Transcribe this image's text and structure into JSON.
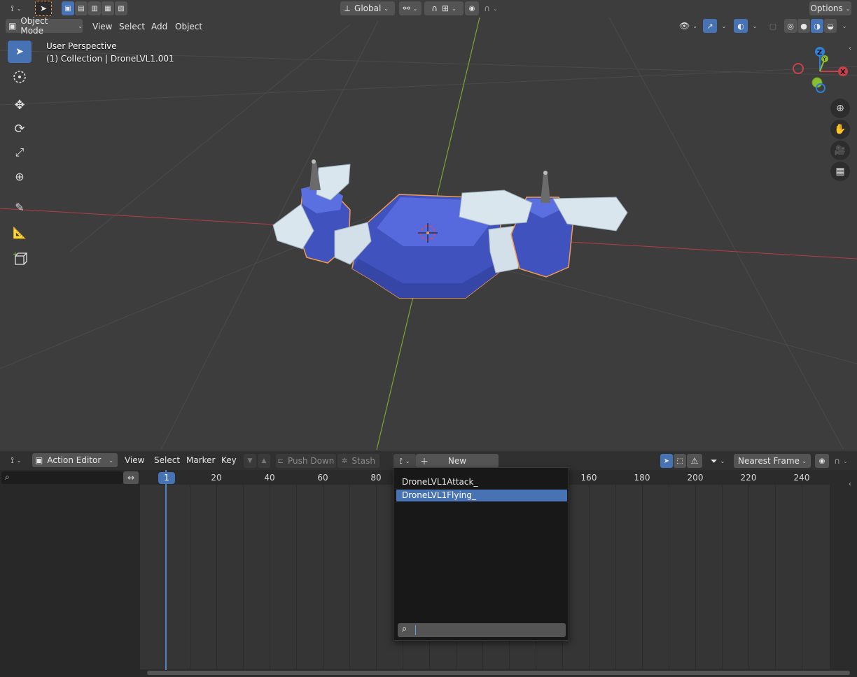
{
  "viewport_header": {
    "transform_orientation": "Global",
    "options_label": "Options"
  },
  "viewport_menu": {
    "mode": "Object Mode",
    "items": [
      "View",
      "Select",
      "Add",
      "Object"
    ]
  },
  "viewport_info": {
    "perspective": "User Perspective",
    "collection": "(1) Collection | DroneLVL1.001"
  },
  "gizmo": {
    "x": "X",
    "y": "Y",
    "z": "Z"
  },
  "action_editor": {
    "editor_type": "Action Editor",
    "menu": [
      "View",
      "Select",
      "Marker",
      "Key"
    ],
    "push_down": "Push Down",
    "stash": "Stash",
    "new_label": "New",
    "snapping": "Nearest Frame",
    "current_frame": "1",
    "ruler_ticks": [
      "20",
      "40",
      "60",
      "80",
      "160",
      "180",
      "200",
      "220",
      "240"
    ]
  },
  "action_popup": {
    "items": [
      "DroneLVL1Attack_",
      "DroneLVL1Flying_"
    ],
    "selected_index": 1
  },
  "colors": {
    "accent": "#4772b3",
    "x_axis": "#c8414a",
    "y_axis": "#8bbe2f",
    "z_axis": "#2f7fd6",
    "selection_outline": "#f39a4f",
    "body_blue": "#4a5ecc"
  }
}
